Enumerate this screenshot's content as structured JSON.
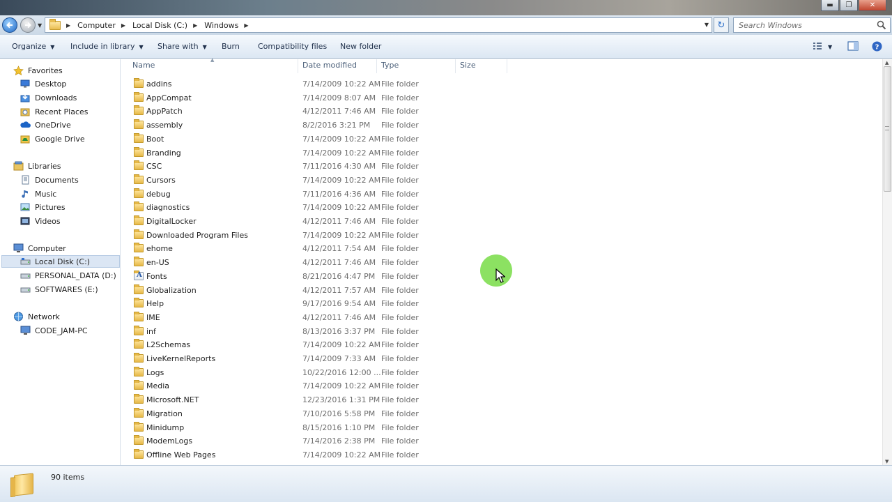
{
  "window": {
    "controls": {
      "minimize": "▬",
      "maximize": "❐",
      "close": "✕"
    }
  },
  "address_bar": {
    "breadcrumb": [
      "Computer",
      "Local Disk (C:)",
      "Windows"
    ],
    "search_placeholder": "Search Windows",
    "refresh_icon": "↻"
  },
  "toolbar": {
    "organize": "Organize",
    "include_in_library": "Include in library",
    "share_with": "Share with",
    "burn": "Burn",
    "compatibility_files": "Compatibility files",
    "new_folder": "New folder"
  },
  "nav_pane": {
    "favorites": {
      "label": "Favorites",
      "items": [
        "Desktop",
        "Downloads",
        "Recent Places",
        "OneDrive",
        "Google Drive"
      ]
    },
    "libraries": {
      "label": "Libraries",
      "items": [
        "Documents",
        "Music",
        "Pictures",
        "Videos"
      ]
    },
    "computer": {
      "label": "Computer",
      "items": [
        "Local Disk (C:)",
        "PERSONAL_DATA (D:)",
        "SOFTWARES (E:)"
      ],
      "selected": "Local Disk (C:)"
    },
    "network": {
      "label": "Network",
      "items": [
        "CODE_JAM-PC"
      ]
    }
  },
  "columns": {
    "name": "Name",
    "date_modified": "Date modified",
    "type": "Type",
    "size": "Size"
  },
  "files": [
    {
      "name": "addins",
      "date": "7/14/2009 10:22 AM",
      "type": "File folder"
    },
    {
      "name": "AppCompat",
      "date": "7/14/2009 8:07 AM",
      "type": "File folder"
    },
    {
      "name": "AppPatch",
      "date": "4/12/2011 7:46 AM",
      "type": "File folder"
    },
    {
      "name": "assembly",
      "date": "8/2/2016 3:21 PM",
      "type": "File folder"
    },
    {
      "name": "Boot",
      "date": "7/14/2009 10:22 AM",
      "type": "File folder"
    },
    {
      "name": "Branding",
      "date": "7/14/2009 10:22 AM",
      "type": "File folder"
    },
    {
      "name": "CSC",
      "date": "7/11/2016 4:30 AM",
      "type": "File folder"
    },
    {
      "name": "Cursors",
      "date": "7/14/2009 10:22 AM",
      "type": "File folder"
    },
    {
      "name": "debug",
      "date": "7/11/2016 4:36 AM",
      "type": "File folder"
    },
    {
      "name": "diagnostics",
      "date": "7/14/2009 10:22 AM",
      "type": "File folder"
    },
    {
      "name": "DigitalLocker",
      "date": "4/12/2011 7:46 AM",
      "type": "File folder"
    },
    {
      "name": "Downloaded Program Files",
      "date": "7/14/2009 10:22 AM",
      "type": "File folder"
    },
    {
      "name": "ehome",
      "date": "4/12/2011 7:54 AM",
      "type": "File folder"
    },
    {
      "name": "en-US",
      "date": "4/12/2011 7:46 AM",
      "type": "File folder"
    },
    {
      "name": "Fonts",
      "date": "8/21/2016 4:47 PM",
      "type": "File folder",
      "icon": "font-folder-icon"
    },
    {
      "name": "Globalization",
      "date": "4/12/2011 7:57 AM",
      "type": "File folder"
    },
    {
      "name": "Help",
      "date": "9/17/2016 9:54 AM",
      "type": "File folder"
    },
    {
      "name": "IME",
      "date": "4/12/2011 7:46 AM",
      "type": "File folder"
    },
    {
      "name": "inf",
      "date": "8/13/2016 3:37 PM",
      "type": "File folder"
    },
    {
      "name": "L2Schemas",
      "date": "7/14/2009 10:22 AM",
      "type": "File folder"
    },
    {
      "name": "LiveKernelReports",
      "date": "7/14/2009 7:33 AM",
      "type": "File folder"
    },
    {
      "name": "Logs",
      "date": "10/22/2016 12:00 ...",
      "type": "File folder"
    },
    {
      "name": "Media",
      "date": "7/14/2009 10:22 AM",
      "type": "File folder"
    },
    {
      "name": "Microsoft.NET",
      "date": "12/23/2016 1:31 PM",
      "type": "File folder"
    },
    {
      "name": "Migration",
      "date": "7/10/2016 5:58 PM",
      "type": "File folder"
    },
    {
      "name": "Minidump",
      "date": "8/15/2016 1:10 PM",
      "type": "File folder"
    },
    {
      "name": "ModemLogs",
      "date": "7/14/2016 2:38 PM",
      "type": "File folder"
    },
    {
      "name": "Offline Web Pages",
      "date": "7/14/2009 10:22 AM",
      "type": "File folder"
    }
  ],
  "status": {
    "item_count": "90 items"
  },
  "colors": {
    "accent": "#2c6fc9",
    "selection": "#dbe6f4",
    "cursor_highlight": "#78dc46"
  }
}
